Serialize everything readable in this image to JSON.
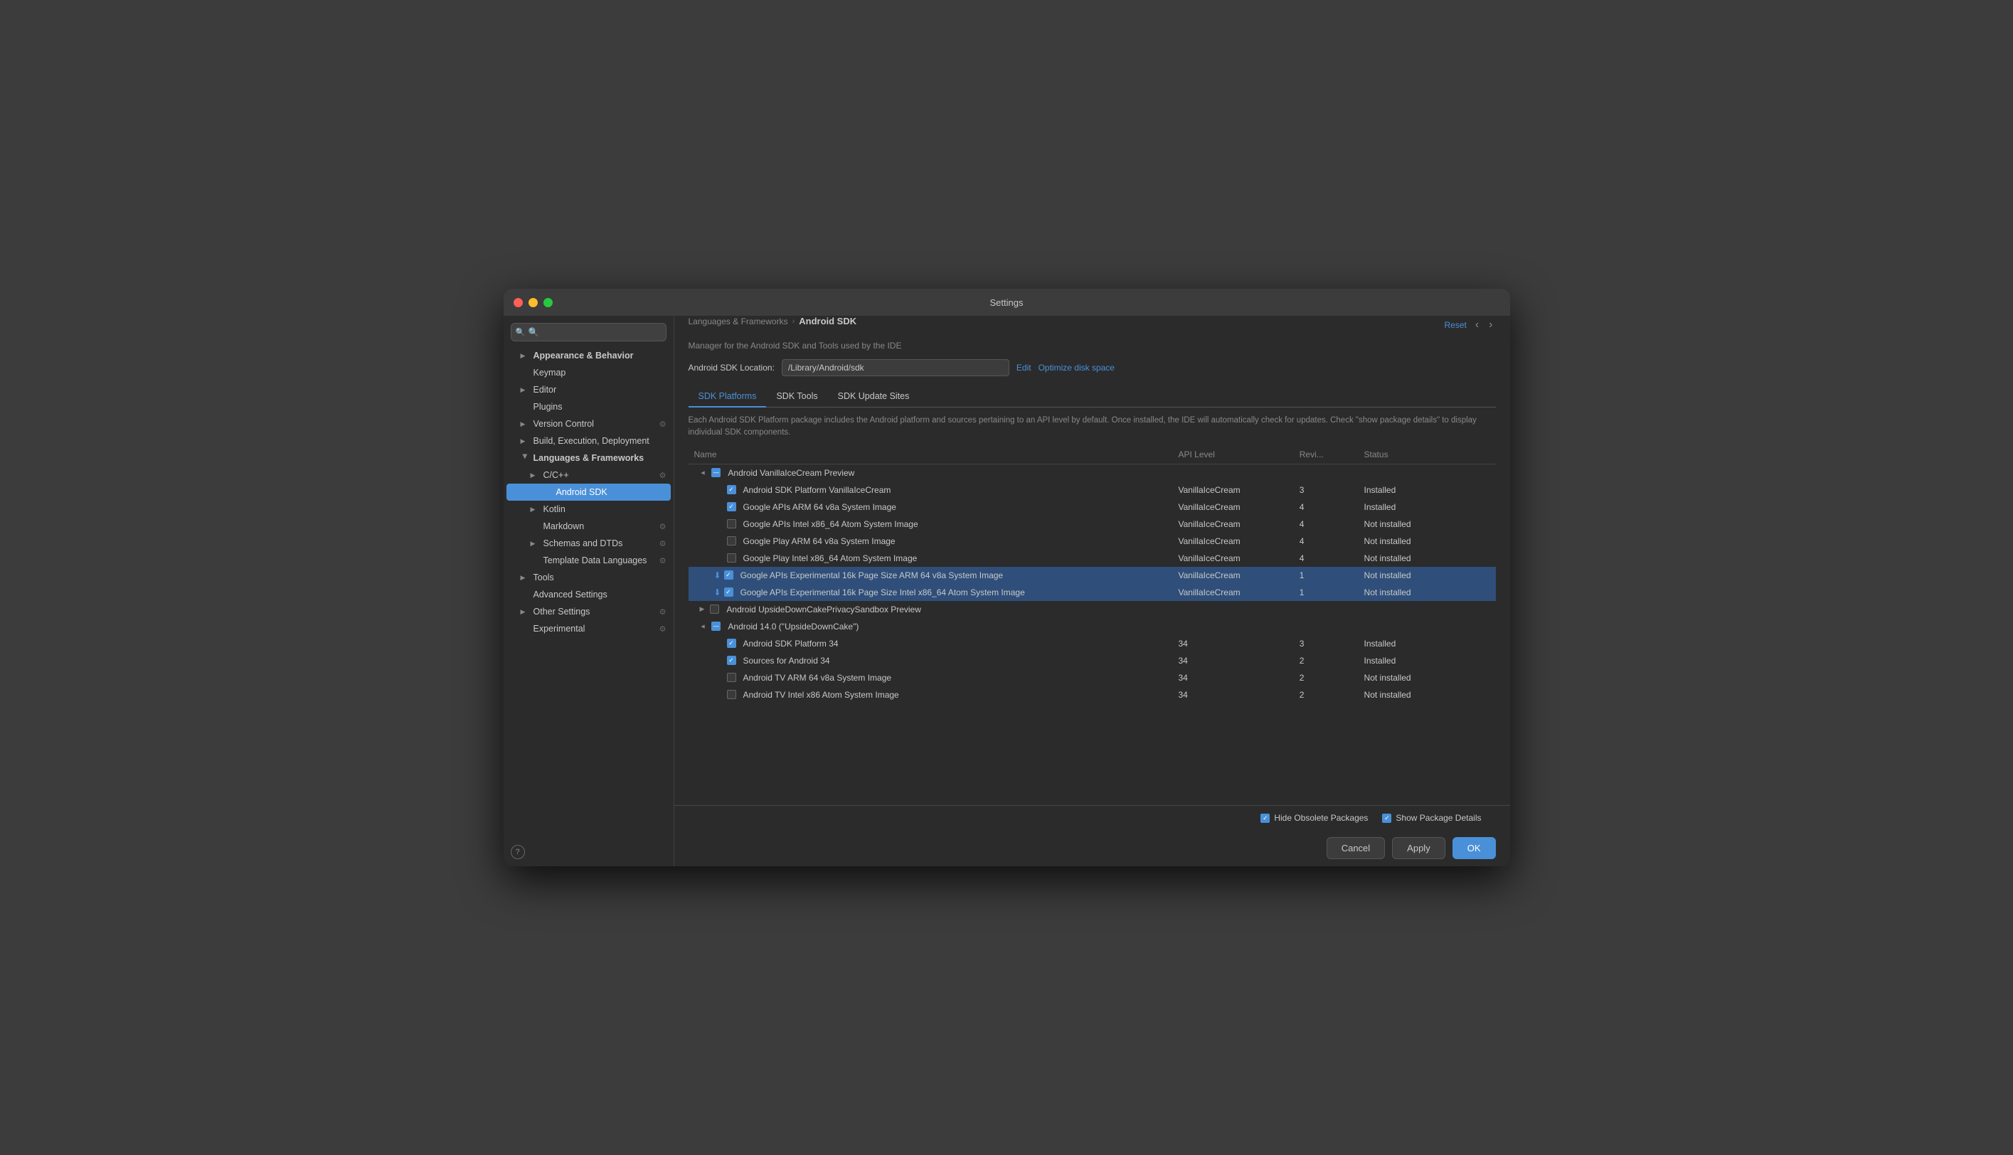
{
  "window": {
    "title": "Settings"
  },
  "sidebar": {
    "search_placeholder": "🔍",
    "items": [
      {
        "id": "appearance",
        "label": "Appearance & Behavior",
        "indent": 1,
        "expandable": true,
        "expanded": false
      },
      {
        "id": "keymap",
        "label": "Keymap",
        "indent": 1,
        "expandable": false
      },
      {
        "id": "editor",
        "label": "Editor",
        "indent": 1,
        "expandable": true,
        "expanded": false
      },
      {
        "id": "plugins",
        "label": "Plugins",
        "indent": 1,
        "expandable": false
      },
      {
        "id": "version-control",
        "label": "Version Control",
        "indent": 1,
        "expandable": true,
        "has_icon": true
      },
      {
        "id": "build-execution",
        "label": "Build, Execution, Deployment",
        "indent": 1,
        "expandable": true
      },
      {
        "id": "languages-frameworks",
        "label": "Languages & Frameworks",
        "indent": 1,
        "expandable": true,
        "expanded": true
      },
      {
        "id": "cpp",
        "label": "C/C++",
        "indent": 2,
        "expandable": true,
        "has_icon": true
      },
      {
        "id": "android-sdk",
        "label": "Android SDK",
        "indent": 3,
        "active": true
      },
      {
        "id": "kotlin",
        "label": "Kotlin",
        "indent": 2,
        "expandable": true
      },
      {
        "id": "markdown",
        "label": "Markdown",
        "indent": 2,
        "has_icon": true
      },
      {
        "id": "schemas-dtds",
        "label": "Schemas and DTDs",
        "indent": 2,
        "expandable": true,
        "has_icon": true
      },
      {
        "id": "template-data",
        "label": "Template Data Languages",
        "indent": 2,
        "has_icon": true
      },
      {
        "id": "tools",
        "label": "Tools",
        "indent": 1,
        "expandable": true
      },
      {
        "id": "advanced-settings",
        "label": "Advanced Settings",
        "indent": 1
      },
      {
        "id": "other-settings",
        "label": "Other Settings",
        "indent": 1,
        "expandable": true,
        "has_icon": true
      },
      {
        "id": "experimental",
        "label": "Experimental",
        "indent": 1,
        "has_icon": true
      }
    ]
  },
  "breadcrumb": {
    "parent": "Languages & Frameworks",
    "current": "Android SDK"
  },
  "header": {
    "reset_label": "Reset",
    "description": "Manager for the Android SDK and Tools used by the IDE",
    "sdk_location_label": "Android SDK Location:",
    "sdk_location_value": "/Library/Android/sdk",
    "edit_label": "Edit",
    "optimize_label": "Optimize disk space"
  },
  "tabs": [
    {
      "id": "sdk-platforms",
      "label": "SDK Platforms",
      "active": true
    },
    {
      "id": "sdk-tools",
      "label": "SDK Tools",
      "active": false
    },
    {
      "id": "sdk-update-sites",
      "label": "SDK Update Sites",
      "active": false
    }
  ],
  "info_text": "Each Android SDK Platform package includes the Android platform and sources pertaining to an API level by default. Once installed, the IDE will automatically check for updates. Check \"show package details\" to display individual SDK components.",
  "table": {
    "columns": [
      "Name",
      "API Level",
      "Revi...",
      "Status"
    ],
    "rows": [
      {
        "type": "group-header",
        "name": "Android VanillaIceCream Preview",
        "expanded": true,
        "checkbox": "indeterminate",
        "api_level": "",
        "revision": "",
        "status": "",
        "indent": 0
      },
      {
        "type": "item",
        "name": "Android SDK Platform VanillaIceCream",
        "checkbox": "checked",
        "api_level": "VanillaIceCream",
        "revision": "3",
        "status": "Installed",
        "indent": 1
      },
      {
        "type": "item",
        "name": "Google APIs ARM 64 v8a System Image",
        "checkbox": "checked",
        "api_level": "VanillaIceCream",
        "revision": "4",
        "status": "Installed",
        "indent": 1
      },
      {
        "type": "item",
        "name": "Google APIs Intel x86_64 Atom System Image",
        "checkbox": "unchecked",
        "api_level": "VanillaIceCream",
        "revision": "4",
        "status": "Not installed",
        "indent": 1
      },
      {
        "type": "item",
        "name": "Google Play ARM 64 v8a System Image",
        "checkbox": "unchecked",
        "api_level": "VanillaIceCream",
        "revision": "4",
        "status": "Not installed",
        "indent": 1
      },
      {
        "type": "item",
        "name": "Google Play Intel x86_64 Atom System Image",
        "checkbox": "unchecked",
        "api_level": "VanillaIceCream",
        "revision": "4",
        "status": "Not installed",
        "indent": 1
      },
      {
        "type": "item",
        "name": "Google APIs Experimental 16k Page Size ARM 64 v8a System Image",
        "checkbox": "checked",
        "api_level": "VanillaIceCream",
        "revision": "1",
        "status": "Not installed",
        "indent": 1,
        "highlighted": true,
        "has_download": true
      },
      {
        "type": "item",
        "name": "Google APIs Experimental 16k Page Size Intel x86_64 Atom System Image",
        "checkbox": "checked",
        "api_level": "VanillaIceCream",
        "revision": "1",
        "status": "Not installed",
        "indent": 1,
        "highlighted": true,
        "has_download": true
      },
      {
        "type": "group-header",
        "name": "Android UpsideDownCakePrivacySandbox Preview",
        "expanded": false,
        "checkbox": "unchecked",
        "api_level": "",
        "revision": "",
        "status": "",
        "indent": 0
      },
      {
        "type": "group-header",
        "name": "Android 14.0 (\"UpsideDownCake\")",
        "expanded": true,
        "checkbox": "indeterminate",
        "api_level": "",
        "revision": "",
        "status": "",
        "indent": 0
      },
      {
        "type": "item",
        "name": "Android SDK Platform 34",
        "checkbox": "checked",
        "api_level": "34",
        "revision": "3",
        "status": "Installed",
        "indent": 1
      },
      {
        "type": "item",
        "name": "Sources for Android 34",
        "checkbox": "checked",
        "api_level": "34",
        "revision": "2",
        "status": "Installed",
        "indent": 1
      },
      {
        "type": "item",
        "name": "Android TV ARM 64 v8a System Image",
        "checkbox": "unchecked",
        "api_level": "34",
        "revision": "2",
        "status": "Not installed",
        "indent": 1
      },
      {
        "type": "item",
        "name": "Android TV Intel x86 Atom System Image",
        "checkbox": "unchecked",
        "api_level": "34",
        "revision": "2",
        "status": "Not installed",
        "indent": 1
      }
    ]
  },
  "bottom": {
    "hide_obsolete_label": "Hide Obsolete Packages",
    "show_package_label": "Show Package Details"
  },
  "footer": {
    "cancel_label": "Cancel",
    "apply_label": "Apply",
    "ok_label": "OK"
  }
}
